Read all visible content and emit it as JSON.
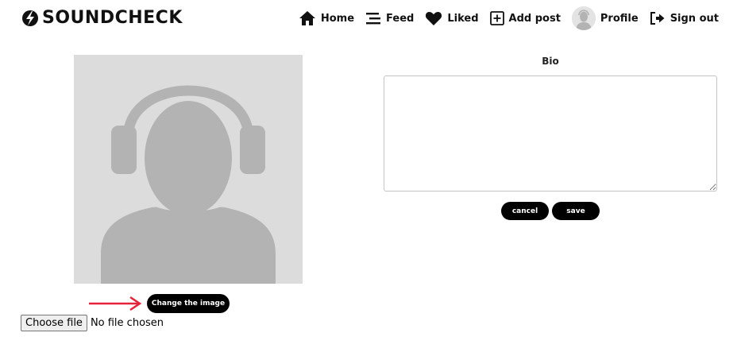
{
  "brand": {
    "name": "SOUNDCHECK",
    "logo_icon": "lightning-bolt-icon"
  },
  "nav": [
    {
      "label": "Home",
      "icon": "home-icon"
    },
    {
      "label": "Feed",
      "icon": "menu-lines-icon"
    },
    {
      "label": "Liked",
      "icon": "heart-icon"
    },
    {
      "label": "Add post",
      "icon": "plus-square-icon"
    },
    {
      "label": "Profile",
      "icon": "avatar"
    },
    {
      "label": "Sign out",
      "icon": "sign-out-icon"
    }
  ],
  "profile_image": {
    "alt_icon": "headphones-person-icon",
    "change_label": "Change the image"
  },
  "file_input": {
    "button_label": "Choose file",
    "status": "No file chosen"
  },
  "bio": {
    "label": "Bio",
    "value": "",
    "cancel_label": "cancel",
    "save_label": "save"
  },
  "colors": {
    "accent": "#000000",
    "arrow": "#e5243b",
    "placeholder_bg": "#dcdcdc",
    "placeholder_fg": "#b0b0b0"
  }
}
